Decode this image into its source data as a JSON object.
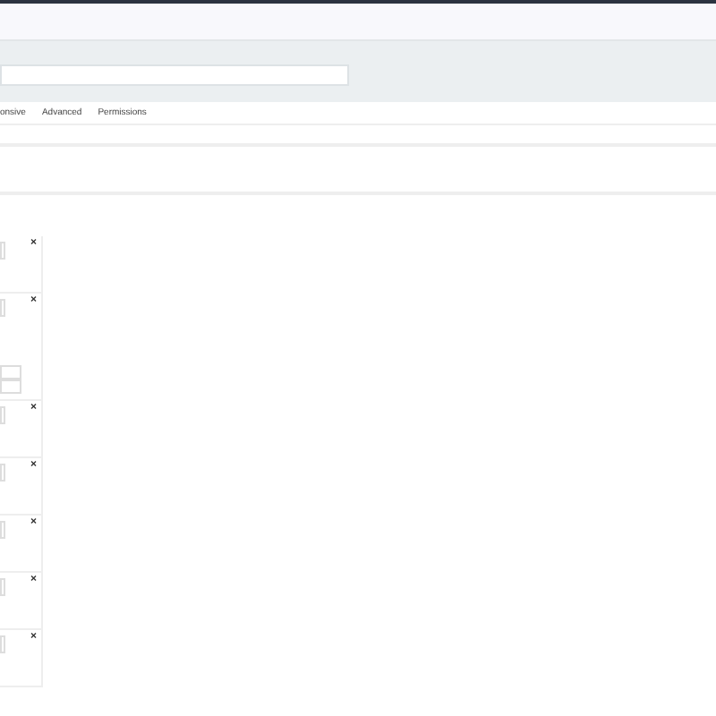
{
  "tabs": [
    {
      "label": "onsive",
      "selected": false
    },
    {
      "label": "Advanced",
      "selected": false
    },
    {
      "label": "Permissions",
      "selected": false
    }
  ],
  "items": [
    {
      "kind": "plain",
      "remove": "×"
    },
    {
      "kind": "with-fields",
      "remove": "×"
    },
    {
      "kind": "plain",
      "remove": "×"
    },
    {
      "kind": "plain",
      "remove": "×"
    },
    {
      "kind": "plain",
      "remove": "×"
    },
    {
      "kind": "plain",
      "remove": "×"
    },
    {
      "kind": "plain",
      "remove": "×"
    }
  ]
}
